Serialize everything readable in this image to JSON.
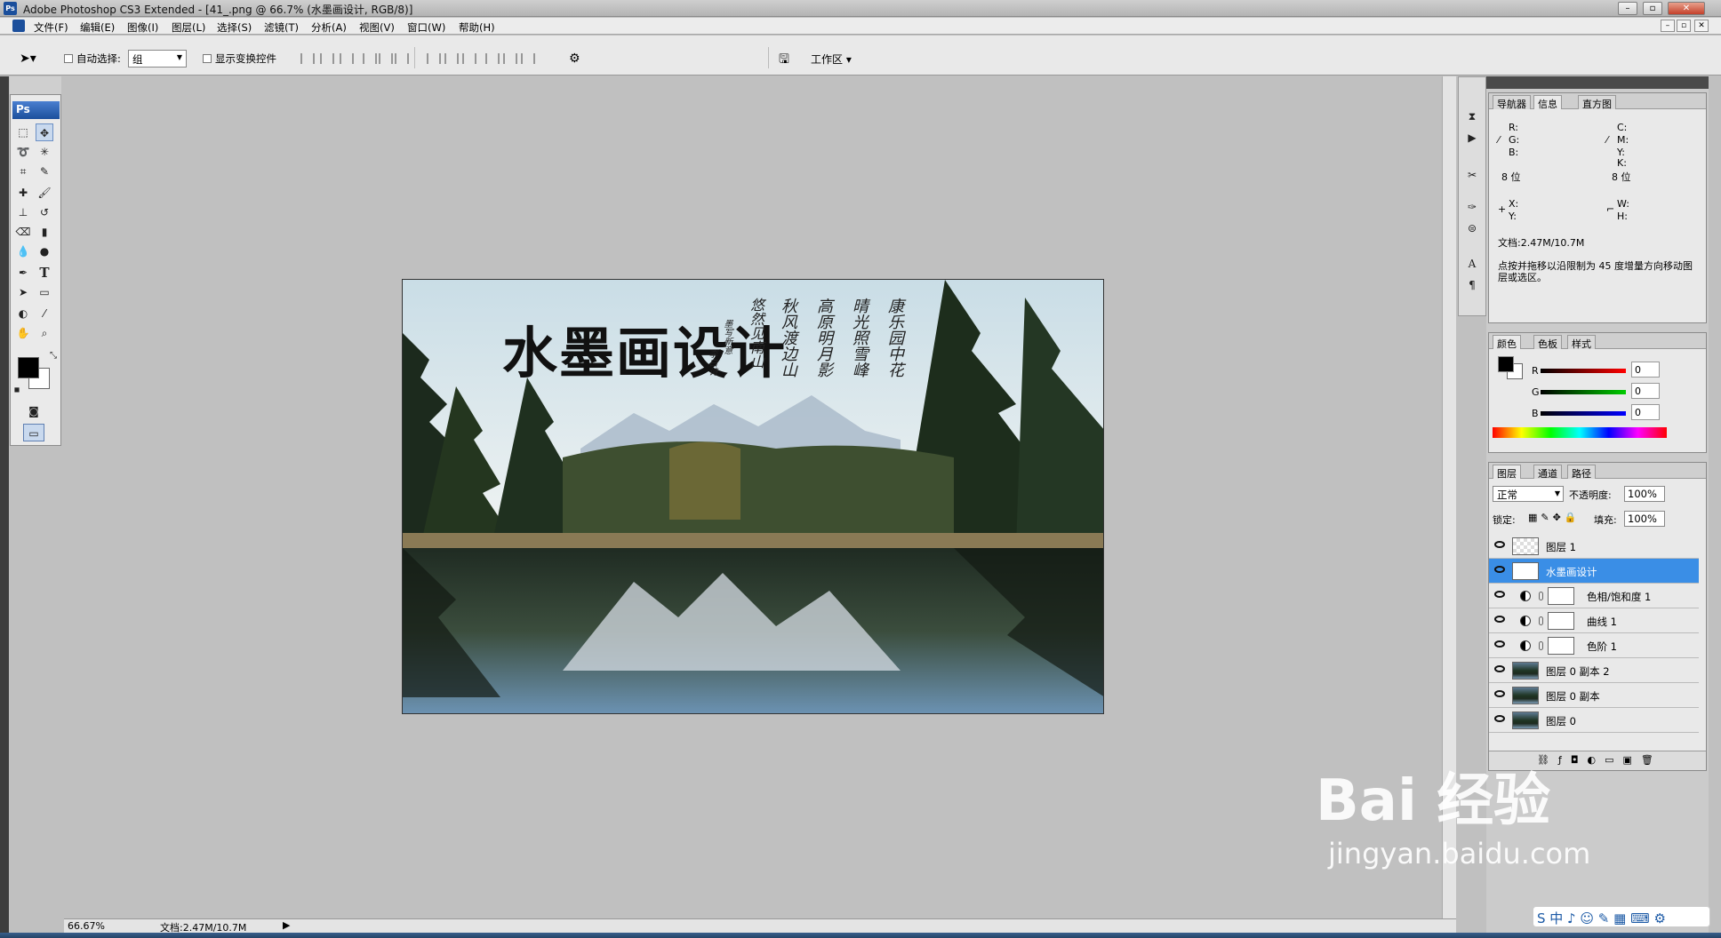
{
  "window": {
    "title": "Adobe Photoshop CS3 Extended - [41_.png @ 66.7% (水墨画设计, RGB/8)]"
  },
  "menu": [
    "文件(F)",
    "编辑(E)",
    "图像(I)",
    "图层(L)",
    "选择(S)",
    "滤镜(T)",
    "分析(A)",
    "视图(V)",
    "窗口(W)",
    "帮助(H)"
  ],
  "options": {
    "auto_select_label": "自动选择:",
    "auto_select_value": "组",
    "show_transform_label": "显示变换控件",
    "workspace_label": "工作区 ▾"
  },
  "document": {
    "title_text": "水墨画设计",
    "calligraphy": [
      "康乐园中花",
      "晴光照雪峰",
      "高原明月影",
      "秋风渡边山",
      "悠然见南山"
    ],
    "signature": [
      "墨写新意",
      "李白诗"
    ]
  },
  "status": {
    "zoom": "66.67%",
    "doc_size": "文档:2.47M/10.7M"
  },
  "info_panel": {
    "tabs": [
      "导航器",
      "信息",
      "直方图"
    ],
    "rgb": [
      "R:",
      "G:",
      "B:"
    ],
    "cmyk": [
      "C:",
      "M:",
      "Y:",
      "K:"
    ],
    "bits_left": "8 位",
    "bits_right": "8 位",
    "xy": [
      "X:",
      "Y:"
    ],
    "wh": [
      "W:",
      "H:"
    ],
    "doc_size": "文档:2.47M/10.7M",
    "hint": "点按并拖移以沿限制为 45 度增量方向移动图层或选区。"
  },
  "color_panel": {
    "tabs": [
      "颜色",
      "色板",
      "样式"
    ],
    "channels": [
      {
        "label": "R",
        "value": "0"
      },
      {
        "label": "G",
        "value": "0"
      },
      {
        "label": "B",
        "value": "0"
      }
    ]
  },
  "layers_panel": {
    "tabs": [
      "图层",
      "通道",
      "路径"
    ],
    "blend_mode": "正常",
    "opacity_label": "不透明度:",
    "opacity": "100%",
    "lock_label": "锁定:",
    "fill_label": "填充:",
    "fill": "100%",
    "layers": [
      {
        "name": "图层 1"
      },
      {
        "name": "水墨画设计"
      },
      {
        "name": "色相/饱和度 1"
      },
      {
        "name": "曲线 1"
      },
      {
        "name": "色阶 1"
      },
      {
        "name": "图层 0 副本 2"
      },
      {
        "name": "图层 0 副本"
      },
      {
        "name": "图层 0"
      }
    ]
  },
  "watermark": {
    "brand": "Bai 经验",
    "url": "jingyan.baidu.com"
  },
  "ime": {
    "text": "S 中 ♪ ☺ ✎ ▦ ⌨ ⚙"
  },
  "toolbox": {
    "logo": "Ps"
  }
}
